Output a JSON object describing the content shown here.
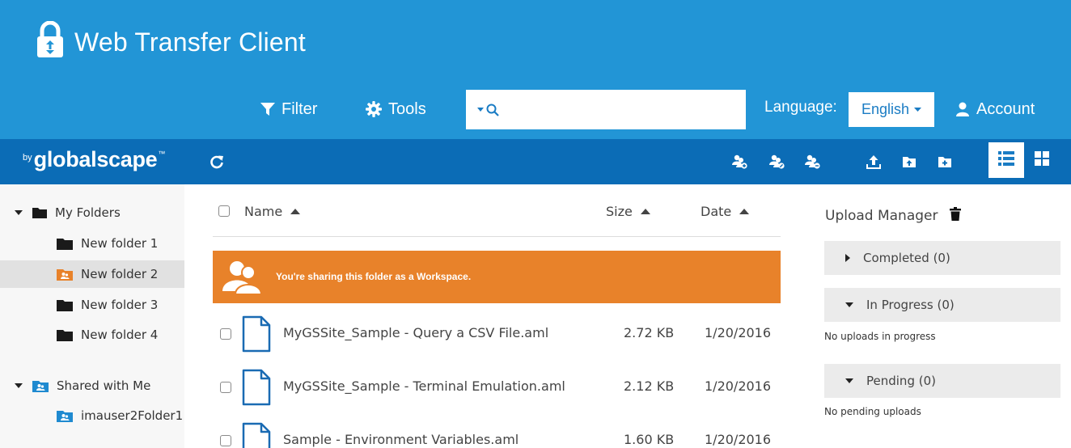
{
  "header": {
    "app_title": "Web Transfer Client",
    "filter_label": "Filter",
    "tools_label": "Tools",
    "search_value": "",
    "language_label": "Language:",
    "language_value": "English",
    "account_label": "Account"
  },
  "toolbar": {
    "brand_by": "by",
    "brand_name": "globalscape",
    "brand_tm": "™",
    "icons": [
      "refresh-icon",
      "add-users-icon",
      "edit-users-icon",
      "remove-users-icon",
      "upload-icon",
      "upload-folder-icon",
      "new-folder-icon",
      "list-view-icon",
      "grid-view-icon"
    ]
  },
  "sidebar": {
    "my_folders": "My Folders",
    "folders": [
      "New folder 1",
      "New folder 2",
      "New folder 3",
      "New folder 4"
    ],
    "shared_with_me": "Shared with Me",
    "shared_folders": [
      "imauser2Folder1"
    ]
  },
  "file_list": {
    "col_name": "Name",
    "col_size": "Size",
    "col_date": "Date",
    "banner_text": "You're sharing this folder as a Workspace.",
    "files": [
      {
        "name": "MyGSSite_Sample - Query a CSV File.aml",
        "size": "2.72 KB",
        "date": "1/20/2016"
      },
      {
        "name": "MyGSSite_Sample - Terminal Emulation.aml",
        "size": "2.12 KB",
        "date": "1/20/2016"
      },
      {
        "name": "Sample - Environment Variables.aml",
        "size": "1.60 KB",
        "date": "1/20/2016"
      }
    ]
  },
  "upload_manager": {
    "title": "Upload Manager",
    "completed": "Completed (0)",
    "in_progress": "In Progress (0)",
    "in_progress_note": "No uploads in progress",
    "pending": "Pending (0)",
    "pending_note": "No pending uploads"
  },
  "colors": {
    "header_bg": "#2295d6",
    "toolbar_bg": "#0b6cb6",
    "banner_bg": "#e8822a",
    "accent": "#1a7cc4"
  }
}
